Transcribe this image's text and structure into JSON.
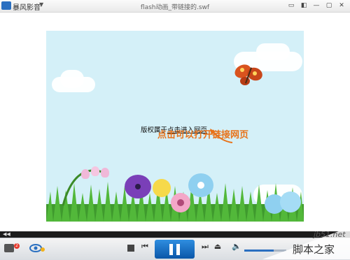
{
  "app": {
    "name": "暴风影音",
    "file_title": "flash动画_带链接的.swf"
  },
  "flash": {
    "note_prefix": "版权属于",
    "note_link": "点击进入网页",
    "annotation": "点击可以打开链接网页"
  },
  "controls": {
    "badge_count": "2"
  },
  "watermark": {
    "site": "jb51.net",
    "brand": "脚本之家"
  },
  "colors": {
    "accent": "#2a6fc0",
    "annotation": "#e8731a",
    "sky": "#d4f0f8"
  }
}
